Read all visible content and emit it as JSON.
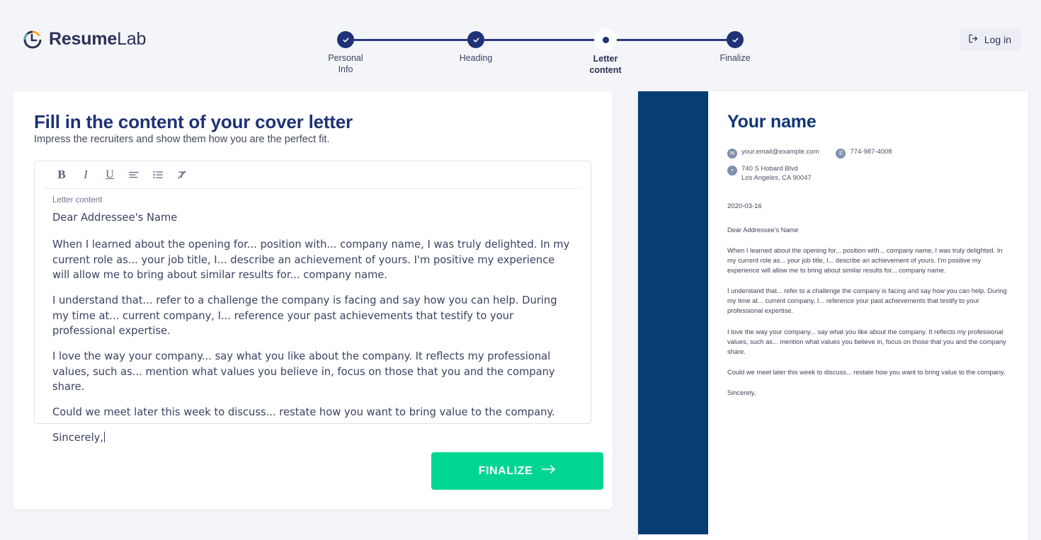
{
  "brand": {
    "name_bold": "Resume",
    "name_light": "Lab",
    "icon": "resumelab-logo-icon"
  },
  "header": {
    "login_label": "Log in",
    "login_icon": "login-arrow-icon",
    "steps": [
      {
        "line1": "Personal",
        "line2": "Info",
        "state": "done",
        "icon": "check-icon"
      },
      {
        "line1": "Heading",
        "line2": "",
        "state": "done",
        "icon": "check-icon"
      },
      {
        "line1": "Letter",
        "line2": "content",
        "state": "current",
        "icon": "dot-icon"
      },
      {
        "line1": "Finalize",
        "line2": "",
        "state": "done",
        "icon": "check-icon"
      }
    ]
  },
  "main": {
    "title": "Fill in the content of your cover letter",
    "subtitle": "Impress the recruiters and show them how you are the perfect fit.",
    "toolbar": [
      {
        "name": "bold-icon",
        "label": "B"
      },
      {
        "name": "italic-icon",
        "label": "I"
      },
      {
        "name": "underline-icon",
        "label": "U"
      },
      {
        "name": "align-left-icon",
        "label": ""
      },
      {
        "name": "bulleted-list-icon",
        "label": ""
      },
      {
        "name": "clear-formatting-icon",
        "label": ""
      }
    ],
    "editor_label": "Letter content",
    "letter": {
      "salutation": "Dear Addressee's Name",
      "paragraphs": [
        "When I learned about the opening for... position with... company name, I was truly delighted. In my current role as... your job title, I... describe an achievement of yours. I'm positive my experience will allow me to bring about similar results for... company name.",
        "I understand that... refer to a challenge the company is facing and say how you can help. During my time at... current company, I... reference your past achievements that testify to your professional expertise.",
        "I love the way your company... say what you like about the company. It reflects my professional values, such as... mention what values you believe in, focus on those that you and the company share.",
        "Could we meet later this week to discuss... restate how you want to bring value to the company."
      ],
      "closing": "Sincerely,"
    },
    "finalize_label": "FINALIZE",
    "finalize_icon": "arrow-right-icon"
  },
  "preview": {
    "name": "Your name",
    "email": "your.email@example.com",
    "email_icon": "envelope-icon",
    "phone": "774-987-4008",
    "phone_icon": "phone-icon",
    "address_line1": "740 S Hobard Blvd",
    "address_line2": "Los Angeles, CA 90047",
    "address_icon": "map-pin-icon",
    "date": "2020-03-16",
    "salutation": "Dear Addressee's Name",
    "paragraphs": [
      "When I learned about the opening for... position with... company name, I was truly delighted. In my current role as... your job title, I... describe an achievement of yours. I'm positive my experience will allow me to bring about similar results for... company name.",
      "I understand that... refer to a challenge the company is facing and say how you can help. During my time at... current company, I... reference your past achievements that testify to your professional expertise.",
      "I love the way your company... say what you like about the company. It reflects my professional values, such as... mention what values you believe in, focus on those that you and the company share.",
      "Could we meet later this week to discuss... restate how you want to bring value to the company."
    ],
    "closing": "Sincerely,"
  },
  "colors": {
    "brand_navy": "#1f3276",
    "accent_green": "#00d692",
    "preview_navy": "#073d73",
    "page_bg": "#f4f5f9"
  }
}
